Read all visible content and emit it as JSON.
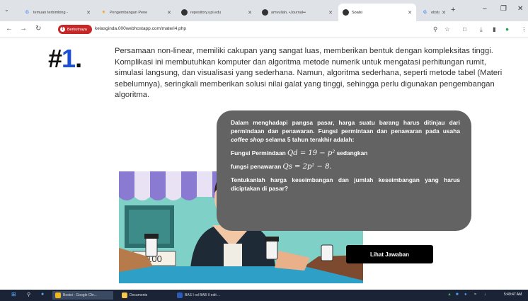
{
  "browser": {
    "tabs": [
      {
        "title": "temuan terbimbing - ",
        "icon": "G"
      },
      {
        "title": "Pengembangan Pene",
        "icon": "✴"
      },
      {
        "title": "repository.upi.edu",
        "icon": "●"
      },
      {
        "title": "amvullah, •Journal••",
        "icon": "●"
      },
      {
        "title": "Soalsi",
        "icon": "●"
      },
      {
        "title": "obstacle korena meo",
        "icon": "G"
      }
    ],
    "badge_label": "Berkutnaya",
    "url": "kelasginda.000webhostapp.com/materi4.php"
  },
  "content": {
    "heading_prefix": "#",
    "heading_number": "1",
    "heading_suffix": ".",
    "intro": "Persamaan non-linear, memiliki cakupan yang sangat luas, memberikan bentuk dengan kompleksitas tinggi. Komplikasi ini membutuhkan komputer dan algoritma metode numerik untuk mengatasi perhitungan rumit, simulasi langsung, dan visualisasi yang sederhana. Namun, algoritma sederhana, seperti metode tabel (Materi sebelumnya), seringkali memberikan solusi nilai galat yang tinggi, sehingga perlu digunakan pengembangan algoritma.",
    "question": {
      "para1_a": "Dalam menghadapi pangsa pasar, harga suatu barang harus ditinjau dari permindaan dan penawaran. Fungsi permintaan dan penawaran pada usaha ",
      "para1_em": "coffee shop",
      "para1_b": " selama 5 tahun terakhir adalah:",
      "demand_label": "Fungsi Permindaan ",
      "demand_formula": "Qd = 19 − p²",
      "demand_suffix": " sedangkan",
      "supply_label": "fungsi penawaran ",
      "supply_formula": "Qs = 2p² − 8.",
      "task": "Tentukanlah harga keseimbangan dan jumlah keseimbangan yang harus diciptakan di pasar?"
    },
    "stall_sign": "100",
    "answer_button": "Lihat Jawaban"
  },
  "taskbar": {
    "items": [
      "Bostoi - Google Chr...",
      "Documents",
      "BAS I od BAB II edit ..."
    ],
    "clock": "5:49:47 AM"
  },
  "colors": {
    "accent": "#1a4fd6",
    "bubble": "#646363",
    "badge": "#c62828",
    "taskbar": "#1a2436"
  }
}
